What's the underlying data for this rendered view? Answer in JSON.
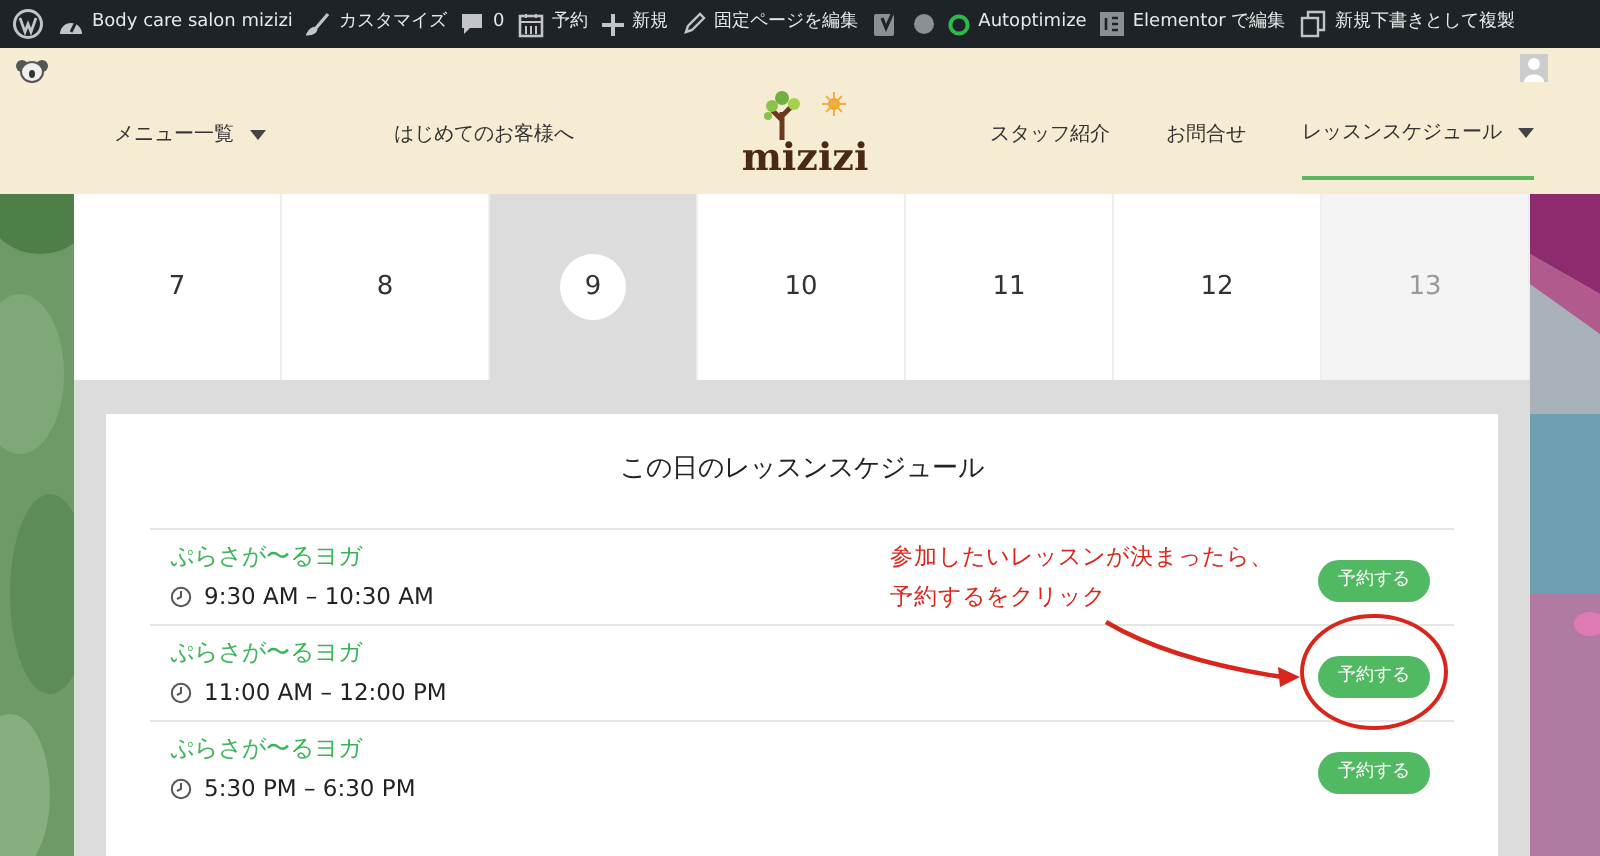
{
  "admin_bar": [
    {
      "kind": "wp"
    },
    {
      "kind": "dashboard",
      "label": "Body care salon mizizi"
    },
    {
      "kind": "brush",
      "label": "カスタマイズ"
    },
    {
      "kind": "comment",
      "label": "0"
    },
    {
      "kind": "calendar",
      "label": "予約"
    },
    {
      "kind": "plus",
      "label": "新規"
    },
    {
      "kind": "pencil",
      "label": "固定ページを編集"
    },
    {
      "kind": "yoast"
    },
    {
      "kind": "dot"
    },
    {
      "kind": "status",
      "label": "Autoptimize"
    },
    {
      "kind": "elementor",
      "label": "Elementor で編集"
    },
    {
      "kind": "copy",
      "label": "新規下書きとして複製"
    }
  ],
  "header": {
    "logo": "mizizi",
    "nav_left": [
      {
        "label": "メニュー一覧",
        "dropdown": true,
        "selected": false
      },
      {
        "label": "はじめてのお客様へ",
        "dropdown": false,
        "selected": false
      }
    ],
    "nav_right": [
      {
        "label": "スタッフ紹介",
        "dropdown": false,
        "selected": false
      },
      {
        "label": "お問合せ",
        "dropdown": false,
        "selected": false
      },
      {
        "label": "レッスンスケジュール",
        "dropdown": true,
        "selected": true
      }
    ]
  },
  "days": [
    {
      "label": "7",
      "selected": false,
      "disabled": false
    },
    {
      "label": "8",
      "selected": false,
      "disabled": false
    },
    {
      "label": "9",
      "selected": true,
      "disabled": false
    },
    {
      "label": "10",
      "selected": false,
      "disabled": false
    },
    {
      "label": "11",
      "selected": false,
      "disabled": false
    },
    {
      "label": "12",
      "selected": false,
      "disabled": false
    },
    {
      "label": "13",
      "selected": false,
      "disabled": true
    }
  ],
  "schedule": {
    "title": "この日のレッスンスケジュール",
    "lessons": [
      {
        "name": "ぷらさが〜るヨガ",
        "time": "9:30 AM – 10:30 AM",
        "button": "予約する",
        "circled": false
      },
      {
        "name": "ぷらさが〜るヨガ",
        "time": "11:00 AM – 12:00 PM",
        "button": "予約する",
        "circled": true
      },
      {
        "name": "ぷらさが〜るヨガ",
        "time": "5:30 PM – 6:30 PM",
        "button": "予約する",
        "circled": false
      }
    ]
  },
  "annotation": {
    "lines": [
      "参加したいレッスンが決まったら、",
      "予約するをクリック"
    ]
  }
}
